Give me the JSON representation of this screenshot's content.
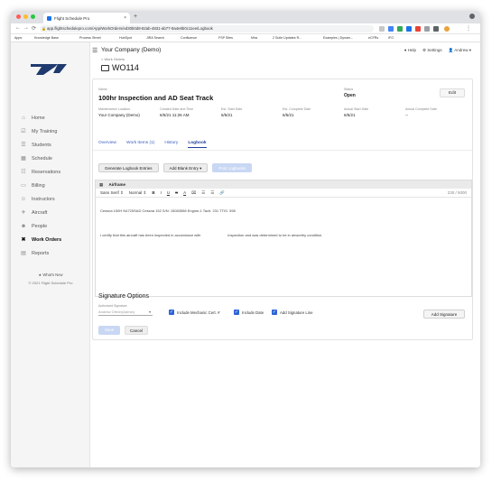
{
  "browser": {
    "tab_title": "Flight Schedule Pro",
    "new_tab": "+",
    "url": "app.flightschedulepro.com/App/WorkOrders/ed30b0d8-82ab-4831-ab77-9a4e8b0c11ee/Logbook",
    "bookmarks": [
      "Apps",
      "Knowledge Base",
      "Process Street",
      "HubSpot",
      "JIRA Search",
      "Confluence",
      "FSP Sites",
      "Mira",
      "2 Suite Updates R...",
      "Examples | Dynam...",
      "eCFRs",
      "IFO"
    ]
  },
  "sidebar": {
    "items": [
      {
        "icon": "home-icon",
        "glyph": "⌂",
        "label": "Home"
      },
      {
        "icon": "training-icon",
        "glyph": "☑",
        "label": "My Training"
      },
      {
        "icon": "students-icon",
        "glyph": "☰",
        "label": "Students"
      },
      {
        "icon": "schedule-icon",
        "glyph": "▦",
        "label": "Schedule"
      },
      {
        "icon": "reservations-icon",
        "glyph": "☷",
        "label": "Reservations"
      },
      {
        "icon": "billing-icon",
        "glyph": "▭",
        "label": "Billing"
      },
      {
        "icon": "instructors-icon",
        "glyph": "☺",
        "label": "Instructors"
      },
      {
        "icon": "aircraft-icon",
        "glyph": "✈",
        "label": "Aircraft"
      },
      {
        "icon": "people-icon",
        "glyph": "☻",
        "label": "People"
      },
      {
        "icon": "work-orders-icon",
        "glyph": "✖",
        "label": "Work Orders"
      },
      {
        "icon": "reports-icon",
        "glyph": "▤",
        "label": "Reports"
      }
    ],
    "whats_new": "★ What's New",
    "copyright": "© 2021 Flight Schedule Pro"
  },
  "header": {
    "company": "Your Company (Demo)",
    "help": "Help",
    "settings": "Settings",
    "user": "Andrew"
  },
  "page": {
    "back_link": "< Work Orders",
    "title": "WO114"
  },
  "details": {
    "name_label": "Name",
    "name": "100hr Inspection and AD Seat Track",
    "status_label": "Status",
    "status": "Open",
    "edit": "Edit",
    "maint_location_label": "Maintenance Location",
    "maint_location": "Your Company (Demo)",
    "created_label": "Created Date and Time",
    "created": "6/5/21 11:26 AM",
    "est_start_label": "Est. Start Date",
    "est_start": "6/5/21",
    "est_complete_label": "Est. Complete Date",
    "est_complete": "6/5/21",
    "actual_start_label": "Actual Start Date",
    "actual_start": "6/5/21",
    "actual_complete_label": "Actual Complete Date",
    "actual_complete": "--"
  },
  "tabs": [
    "Overview",
    "Work Items (1)",
    "History",
    "Logbook"
  ],
  "buttons": {
    "generate": "Generate Logbook Entries",
    "add_blank": "Add Blank Entry ▾",
    "post": "Post Logbooks"
  },
  "editor": {
    "header_icon": "▦",
    "header_title": "Airframe",
    "font": "Sans Serif ⇕",
    "size": "Normal ⇕",
    "counter": "230 / 5000",
    "line1": "Cessna 150H   N4725SAD Cessna 152   S/N: 15083558   Engine-1 Tach: 231   TTIS: 398",
    "line2a": "I certify that this aircraft has been inspected in accordance with",
    "line2b": "inspection and was determined to be in airworthy condition."
  },
  "signature": {
    "title": "Signature Options",
    "auth_label": "Authorized Signature",
    "auth_value": "Andrew Ortner(Admin)",
    "include_mech": "Include Mechanic Cert. #",
    "include_date": "Include Date",
    "add_sig_line": "Add Signature Line",
    "add_signature": "Add Signature",
    "save": "Save",
    "cancel": "Cancel"
  }
}
